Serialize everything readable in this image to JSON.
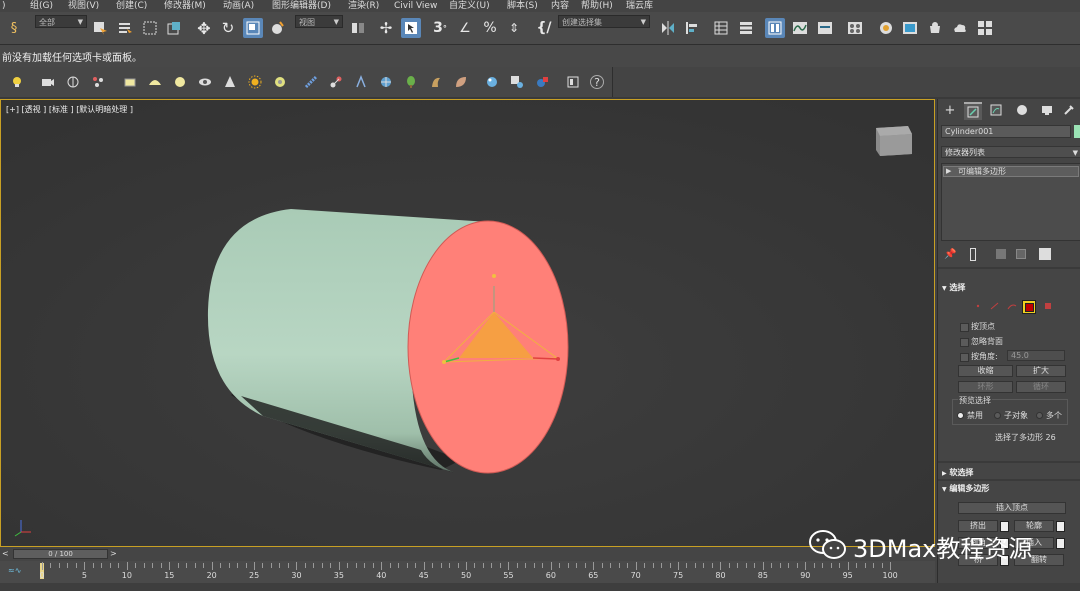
{
  "menubar": {
    "items": [
      "组(G)",
      "视图(V)",
      "创建(C)",
      "修改器(M)",
      "动画(A)",
      "图形编辑器(D)",
      "渲染(R)",
      "Civil View",
      "自定义(U)",
      "脚本(S)",
      "内容",
      "帮助(H)",
      "瑞云库"
    ],
    "first_fragment": ")"
  },
  "toolbar": {
    "selection_filter": "全部",
    "ref_coord": "视图",
    "named_selection": "创建选择集"
  },
  "hint": {
    "text": "前没有加载任何选项卡或面板。"
  },
  "viewport": {
    "label_plus": "[+]",
    "label_view": "[透视 ]",
    "label_mode": "[标准 ]",
    "label_shading": "[默认明暗处理 ]"
  },
  "command_panel": {
    "object_name": "Cylinder001",
    "object_color": "#9be3b5",
    "modifier_list": "修改器列表",
    "stack_item": "可编辑多边形",
    "selection_rollout": {
      "title": "选择",
      "by_vertex": "按顶点",
      "ignore_backfacing": "忽略背面",
      "by_angle": "按角度:",
      "angle_value": "45.0",
      "shrink": "收缩",
      "grow": "扩大",
      "ring": "环形",
      "loop": "循环",
      "preview_title": "预览选择",
      "preview_disabled": "禁用",
      "preview_subobject": "子对象",
      "preview_multi": "多个",
      "status": "选择了多边形 26"
    },
    "soft_selection_title": "软选择",
    "edit_polygons": {
      "title": "编辑多边形",
      "insert_vertex": "插入顶点",
      "extrude": "挤出",
      "outline": "轮廓",
      "bevel": "倒角",
      "inset": "插入",
      "bridge": "桥",
      "flip": "翻转"
    }
  },
  "timeline": {
    "frame_counter": "0 / 100",
    "ticks": [
      "0",
      "5",
      "10",
      "15",
      "20",
      "25",
      "30",
      "35",
      "40",
      "45",
      "50",
      "55",
      "60",
      "65",
      "70",
      "75",
      "80",
      "85",
      "90",
      "95",
      "100"
    ]
  },
  "watermark": {
    "text": "3DMax教程资源"
  },
  "colors": {
    "cylinder_side": "#b5d2bf",
    "selected_face": "#ff8078",
    "gizmo": "#f0a030",
    "viewport_border": "#c8a024",
    "active_button": "#5a87b8"
  }
}
